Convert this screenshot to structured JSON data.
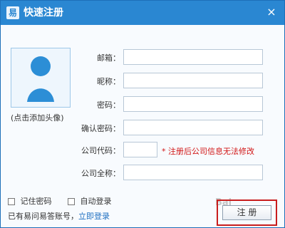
{
  "window": {
    "title": "快速注册",
    "logo_text": "易",
    "close_icon": "×"
  },
  "avatar": {
    "caption": "(点击添加头像)"
  },
  "form": {
    "email_label": "邮箱：",
    "nickname_label": "昵称：",
    "password_label": "密码：",
    "confirm_password_label": "确认密码：",
    "company_code_label": "公司代码：",
    "company_code_note_star": "*",
    "company_code_note": " 注册后公司信息无法修改",
    "company_name_label": "公司全称：",
    "email_value": "",
    "nickname_value": "",
    "password_value": "",
    "confirm_password_value": "",
    "company_code_value": "",
    "company_name_value": ""
  },
  "options": {
    "remember_password": "记住密码",
    "auto_login": "自动登录"
  },
  "footer": {
    "existing_account_text": "已有易问易答账号，",
    "login_link": "立即登录"
  },
  "buttons": {
    "register_label": "注 册"
  },
  "watermark_text": "Bai"
}
